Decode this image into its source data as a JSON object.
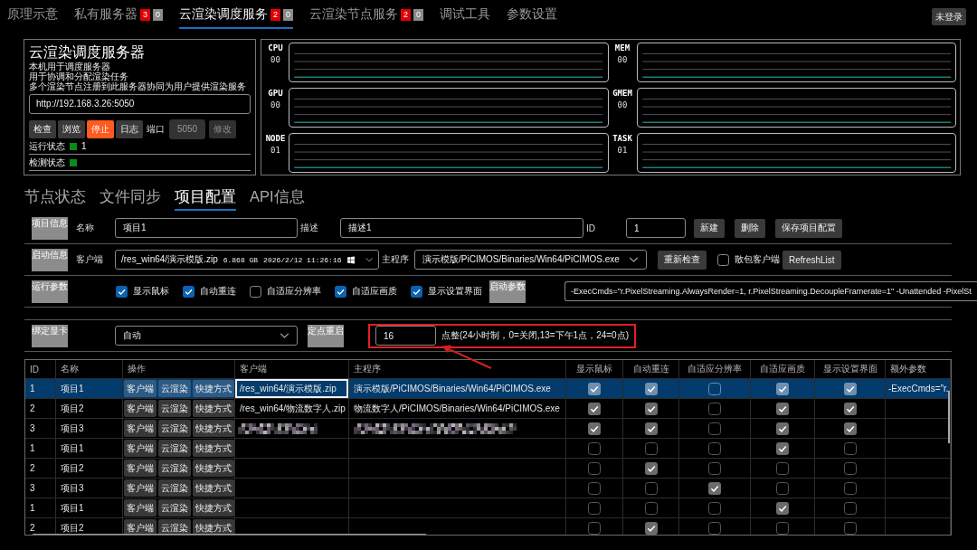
{
  "nav_tabs": [
    {
      "label": "原理示意",
      "selected": false
    },
    {
      "label": "私有服务器",
      "selected": false,
      "badges": [
        {
          "count": "3",
          "color": "#e00000"
        },
        {
          "count": "0",
          "color": "#8a8a8a"
        }
      ]
    },
    {
      "label": "云渲染调度服务",
      "selected": true,
      "badges": [
        {
          "count": "2",
          "color": "#e00000"
        },
        {
          "count": "0",
          "color": "#8a8a8a"
        }
      ]
    },
    {
      "label": "云渲染节点服务",
      "selected": false,
      "badges": [
        {
          "count": "2",
          "color": "#e00000"
        },
        {
          "count": "0",
          "color": "#8a8a8a"
        }
      ]
    },
    {
      "label": "调试工具",
      "selected": false
    },
    {
      "label": "参数设置",
      "selected": false
    }
  ],
  "login_button": "未登录",
  "server": {
    "title": "云渲染调度服务器",
    "description": [
      "本机用于调度服务器",
      "用于协调和分配渲染任务",
      "多个渲染节点注册到此服务器协同为用户提供渲染服务"
    ],
    "url": "http://192.168.3.26:5050",
    "buttons": [
      {
        "label": "检查",
        "kind": "normal"
      },
      {
        "label": "浏览",
        "kind": "normal"
      },
      {
        "label": "停止",
        "kind": "danger"
      },
      {
        "label": "日志",
        "kind": "normal"
      }
    ],
    "port_label": "端口",
    "port": {
      "value": "5050",
      "disabled": true
    },
    "modify_button": {
      "label": "修改",
      "disabled": true
    },
    "status": [
      {
        "label": "运行状态",
        "ok": true,
        "value": "1"
      },
      {
        "label": "检测状态",
        "ok": true
      }
    ]
  },
  "monitors": [
    {
      "label": "CPU",
      "value": "00"
    },
    {
      "label": "MEM",
      "value": "00"
    },
    {
      "label": "GPU",
      "value": "00"
    },
    {
      "label": "GMEM",
      "value": "00"
    },
    {
      "label": "NODE",
      "value": "01"
    },
    {
      "label": "TASK",
      "value": "01"
    }
  ],
  "sub_tabs": [
    {
      "label": "节点状态",
      "selected": false
    },
    {
      "label": "文件同步",
      "selected": false
    },
    {
      "label": "项目配置",
      "selected": true
    },
    {
      "label": "API信息",
      "selected": false
    }
  ],
  "project_info": {
    "tag": "项目信息",
    "name_label": "名称",
    "name": "项目1",
    "desc_label": "描述",
    "desc": "描述1",
    "id_label": "ID",
    "id": "1",
    "buttons": [
      "新建",
      "删除",
      "保存项目配置"
    ]
  },
  "launch_info": {
    "tag": "启动信息",
    "client_label": "客户端",
    "client": {
      "path": "/res_win64/演示模版.zip",
      "size": "6.868 GB",
      "modified": "2026/2/12 11:26:16"
    },
    "program_label": "主程序",
    "program": "演示模版/PiCIMOS/Binaries/Win64/PiCIMOS.exe",
    "recheck_button": "重新检查",
    "loose_client": {
      "label": "散包客户端",
      "checked": false
    },
    "refresh_button": "RefreshList"
  },
  "run_params": {
    "tag": "运行参数",
    "options": [
      {
        "label": "显示鼠标",
        "checked": true
      },
      {
        "label": "自动重连",
        "checked": true
      },
      {
        "label": "自适应分辨率",
        "checked": false
      },
      {
        "label": "自适应画质",
        "checked": true
      },
      {
        "label": "显示设置界面",
        "checked": true
      }
    ],
    "launch_args_tag": "启动参数",
    "launch_args": "-ExecCmds=\"r.PixelStreaming.AlwaysRender=1, r.PixelStreaming.DecoupleFramerate=1\" -Unattended -PixelSt"
  },
  "gpu_binding": {
    "tag": "绑定显卡",
    "value": "自动",
    "restart_tag": "定点重启",
    "restart_hour": "16",
    "restart_hint": "点整(24小时制，0=关闭,13=下午1点，24=0点)",
    "highlighted": true
  },
  "table": {
    "columns": [
      "ID",
      "名称",
      "操作",
      "客户端",
      "主程序",
      "显示鼠标",
      "自动重连",
      "自适应分辨率",
      "自适应画质",
      "显示设置界面",
      "额外参数"
    ],
    "rows": [
      {
        "id": "1",
        "name": "项目1",
        "actions": [
          "客户端",
          "云渲染",
          "快捷方式"
        ],
        "client": "/res_win64/演示模版.zip",
        "program": "演示模版/PiCIMOS/Binaries/Win64/PiCIMOS.exe",
        "checks": [
          true,
          true,
          false,
          true,
          true
        ],
        "extra": "-ExecCmds=\"r.",
        "selected": true,
        "focused": true,
        "redacted": false
      },
      {
        "id": "2",
        "name": "项目2",
        "actions": [
          "客户端",
          "云渲染",
          "快捷方式"
        ],
        "client": "/res_win64/物流数字人.zip",
        "program": "物流数字人/PiCIMOS/Binaries/Win64/PiCIMOS.exe",
        "checks": [
          true,
          true,
          false,
          true,
          true
        ],
        "selected": false,
        "focused": false,
        "redacted": false
      },
      {
        "id": "3",
        "name": "项目3",
        "actions": [
          "客户端",
          "云渲染",
          "快捷方式"
        ],
        "checks": [
          true,
          true,
          false,
          true,
          true
        ],
        "selected": false,
        "focused": false,
        "redacted": true
      },
      {
        "id": "1",
        "name": "项目1",
        "actions": [
          "客户端",
          "云渲染",
          "快捷方式"
        ],
        "checks": [
          false,
          false,
          false,
          true,
          false
        ],
        "selected": false,
        "focused": false,
        "redacted": false
      },
      {
        "id": "2",
        "name": "项目2",
        "actions": [
          "客户端",
          "云渲染",
          "快捷方式"
        ],
        "checks": [
          false,
          true,
          false,
          false,
          false
        ],
        "selected": false,
        "focused": false,
        "redacted": false
      },
      {
        "id": "3",
        "name": "项目3",
        "actions": [
          "客户端",
          "云渲染",
          "快捷方式"
        ],
        "checks": [
          false,
          false,
          true,
          false,
          false
        ],
        "selected": false,
        "focused": false,
        "redacted": false
      },
      {
        "id": "1",
        "name": "项目1",
        "actions": [
          "客户端",
          "云渲染",
          "快捷方式"
        ],
        "checks": [
          false,
          false,
          false,
          true,
          false
        ],
        "selected": false,
        "focused": false,
        "redacted": false
      },
      {
        "id": "2",
        "name": "项目2",
        "actions": [
          "客户端",
          "云渲染",
          "快捷方式"
        ],
        "checks": [
          false,
          true,
          false,
          false,
          false
        ],
        "selected": false,
        "focused": false,
        "redacted": false
      }
    ]
  }
}
